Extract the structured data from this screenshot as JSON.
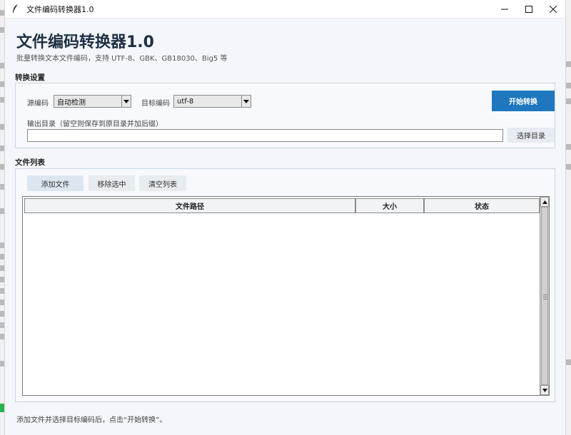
{
  "window": {
    "title": "文件编码转换器1.0",
    "controls": [
      "minimize-icon",
      "maximize-icon",
      "close-icon"
    ]
  },
  "header": {
    "title": "文件编码转换器1.0",
    "subtitle": "批量转换文本文件编码，支持 UTF-8、GBK、GB18030、Big5 等"
  },
  "settings": {
    "section_title": "转换设置",
    "source_label": "源编码",
    "source_value": "自动检测",
    "target_label": "目标编码",
    "target_value": "utf-8",
    "start_button": "开始转换",
    "output_label": "输出目录（留空则保存到原目录并加后缀）",
    "output_value": "",
    "choose_dir_button": "选择目录"
  },
  "files": {
    "section_title": "文件列表",
    "add_button": "添加文件",
    "remove_button": "移除选中",
    "clear_button": "清空列表",
    "columns": [
      "文件路径",
      "大小",
      "状态"
    ],
    "rows": []
  },
  "status": {
    "text": "添加文件并选择目标编码后，点击“开始转换”。"
  },
  "colors": {
    "accent": "#1f78bf",
    "title": "#1f3044",
    "background": "#f3f6fa"
  }
}
